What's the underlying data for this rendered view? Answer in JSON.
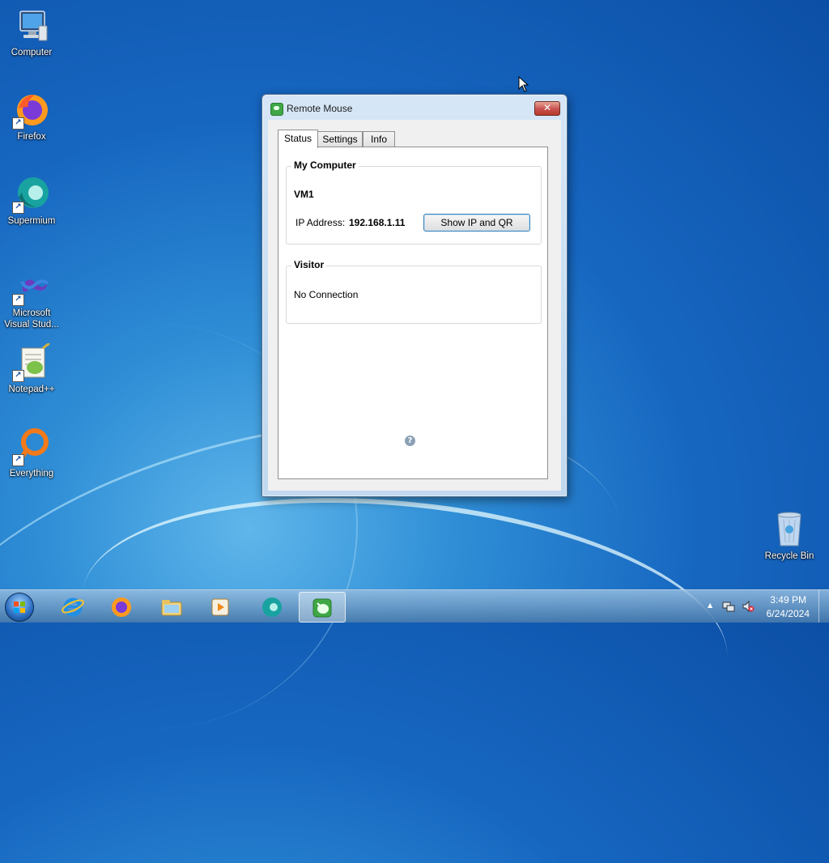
{
  "desktop": {
    "icons": [
      {
        "label": "Computer",
        "icon": "computer-icon"
      },
      {
        "label": "Firefox",
        "icon": "firefox-icon"
      },
      {
        "label": "Supermium",
        "icon": "supermium-icon"
      },
      {
        "label": "Microsoft Visual Stud...",
        "icon": "visual-studio-icon"
      },
      {
        "label": "Notepad++",
        "icon": "notepad-plus-plus-icon"
      },
      {
        "label": "Everything",
        "icon": "everything-icon"
      }
    ],
    "recycle_bin": {
      "label": "Recycle Bin",
      "icon": "recycle-bin-icon"
    }
  },
  "window": {
    "title": "Remote Mouse",
    "close_glyph": "✕",
    "tabs": [
      {
        "label": "Status",
        "active": true
      },
      {
        "label": "Settings",
        "active": false
      },
      {
        "label": "Info",
        "active": false
      }
    ],
    "my_computer": {
      "title": "My Computer",
      "computer_name": "VM1",
      "ip_label": "IP Address:",
      "ip_value": "192.168.1.11",
      "button_label": "Show IP and QR"
    },
    "visitor": {
      "title": "Visitor",
      "status": "No Connection"
    },
    "help_glyph": "?"
  },
  "taskbar": {
    "items": [
      {
        "name": "internet-explorer",
        "icon": "internet-explorer-icon",
        "active": false
      },
      {
        "name": "firefox",
        "icon": "firefox-icon",
        "active": false
      },
      {
        "name": "file-explorer",
        "icon": "folder-icon",
        "active": false
      },
      {
        "name": "media-player",
        "icon": "media-player-icon",
        "active": false
      },
      {
        "name": "supermium",
        "icon": "supermium-icon",
        "active": false
      },
      {
        "name": "remote-mouse",
        "icon": "remote-mouse-icon",
        "active": true
      }
    ],
    "tray": {
      "show_hidden_glyph": "▲",
      "time": "3:49 PM",
      "date": "6/24/2024"
    }
  },
  "colors": {
    "desktop_accent": "#1666c0",
    "close_button": "#c75050",
    "button_border": "#3c7fb1"
  }
}
